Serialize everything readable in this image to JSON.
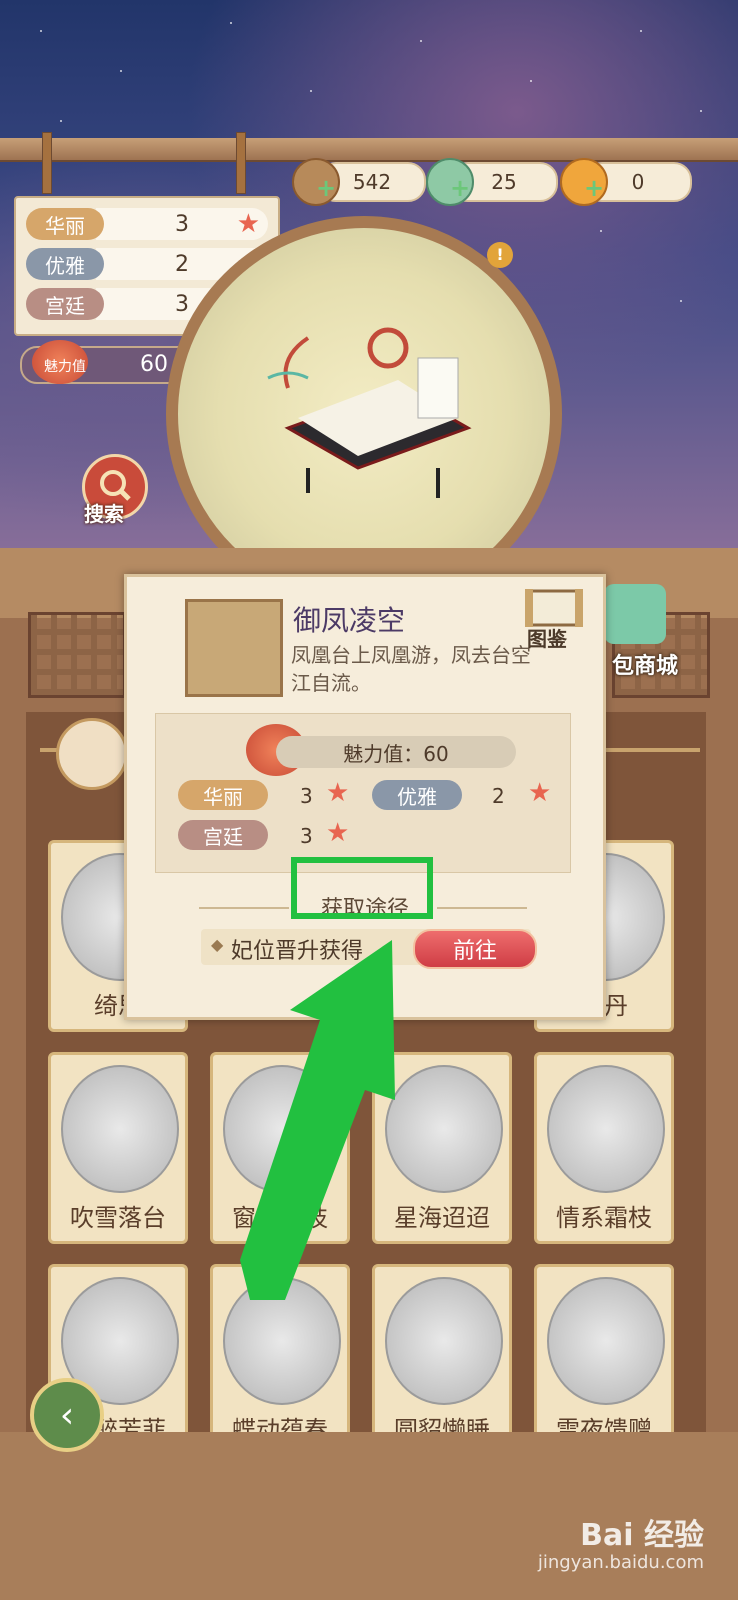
{
  "currency": [
    {
      "icon": "copper-coin-icon",
      "value": "542"
    },
    {
      "icon": "jade-icon",
      "value": "25"
    },
    {
      "icon": "gold-ingot-icon",
      "value": "0"
    }
  ],
  "attributes": [
    {
      "label": "华丽",
      "value": "3",
      "color": "#d6a66a"
    },
    {
      "label": "优雅",
      "value": "2",
      "color": "#8a97a8"
    },
    {
      "label": "宫廷",
      "value": "3",
      "color": "#b88e84"
    }
  ],
  "charm": {
    "label": "魅力值",
    "value": "60"
  },
  "search": {
    "label": "搜索"
  },
  "popup": {
    "title": "御凤凌空",
    "description": "凤凰台上凤凰游，凤去台空江自流。",
    "atlas_label": "图鉴",
    "charm_text": "魅力值：60",
    "stats": [
      {
        "label": "华丽",
        "value": "3",
        "color": "#d6a66a"
      },
      {
        "label": "优雅",
        "value": "2",
        "color": "#8a97a8"
      },
      {
        "label": "宫廷",
        "value": "3",
        "color": "#b88e84"
      }
    ],
    "obtain_title": "获取途径",
    "source_text": "妃位晋升获得",
    "go_label": "前往"
  },
  "shop_label": "包商城",
  "cards_row1": [
    "绮思",
    "牡丹"
  ],
  "cards_row2": [
    "吹雪落台",
    "窗含一枝",
    "星海迢迢",
    "情系霜枝"
  ],
  "cards_row3": [
    "晨醉芳菲",
    "蝶动蕴春",
    "圆貂懒睡",
    "雪夜馈赠"
  ],
  "watermark": {
    "brand": "Bai 经验",
    "url": "jingyan.baidu.com"
  }
}
